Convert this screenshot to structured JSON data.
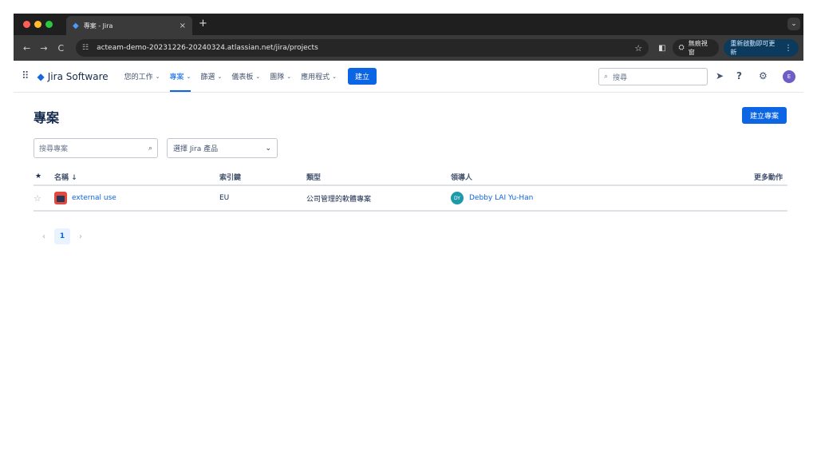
{
  "browser": {
    "tab_title": "專案 - Jira",
    "tab_close": "×",
    "new_tab": "+",
    "tab_menu": "⌄",
    "nav_back": "←",
    "nav_forward": "→",
    "nav_reload": "C",
    "url": "acteam-demo-20231226-20240324.atlassian.net/jira/projects",
    "bookmark": "☆",
    "incognito_label": "無痕視窗",
    "update_label": "重新啟動即可更新"
  },
  "jira_nav": {
    "logo_text": "Jira Software",
    "items": [
      {
        "label": "您的工作",
        "active": false
      },
      {
        "label": "專案",
        "active": true
      },
      {
        "label": "篩選",
        "active": false
      },
      {
        "label": "儀表板",
        "active": false
      },
      {
        "label": "團隊",
        "active": false
      },
      {
        "label": "應用程式",
        "active": false
      }
    ],
    "create_label": "建立",
    "search_placeholder": "搜尋",
    "avatar_initial": "E"
  },
  "page": {
    "title": "專案",
    "create_project_label": "建立專案",
    "search_placeholder": "搜尋專案",
    "product_select_label": "選擇 Jira 產品"
  },
  "table": {
    "columns": {
      "star": "★",
      "name": "名稱 ↓",
      "key": "索引鍵",
      "type": "類型",
      "lead": "領導人",
      "actions": "更多動作"
    },
    "rows": [
      {
        "name": "external use",
        "key": "EU",
        "type": "公司管理的軟體專案",
        "lead_initials": "DY",
        "lead_name": "Debby LAI Yu-Han"
      }
    ]
  },
  "pagination": {
    "prev": "‹",
    "current": "1",
    "next": "›"
  }
}
